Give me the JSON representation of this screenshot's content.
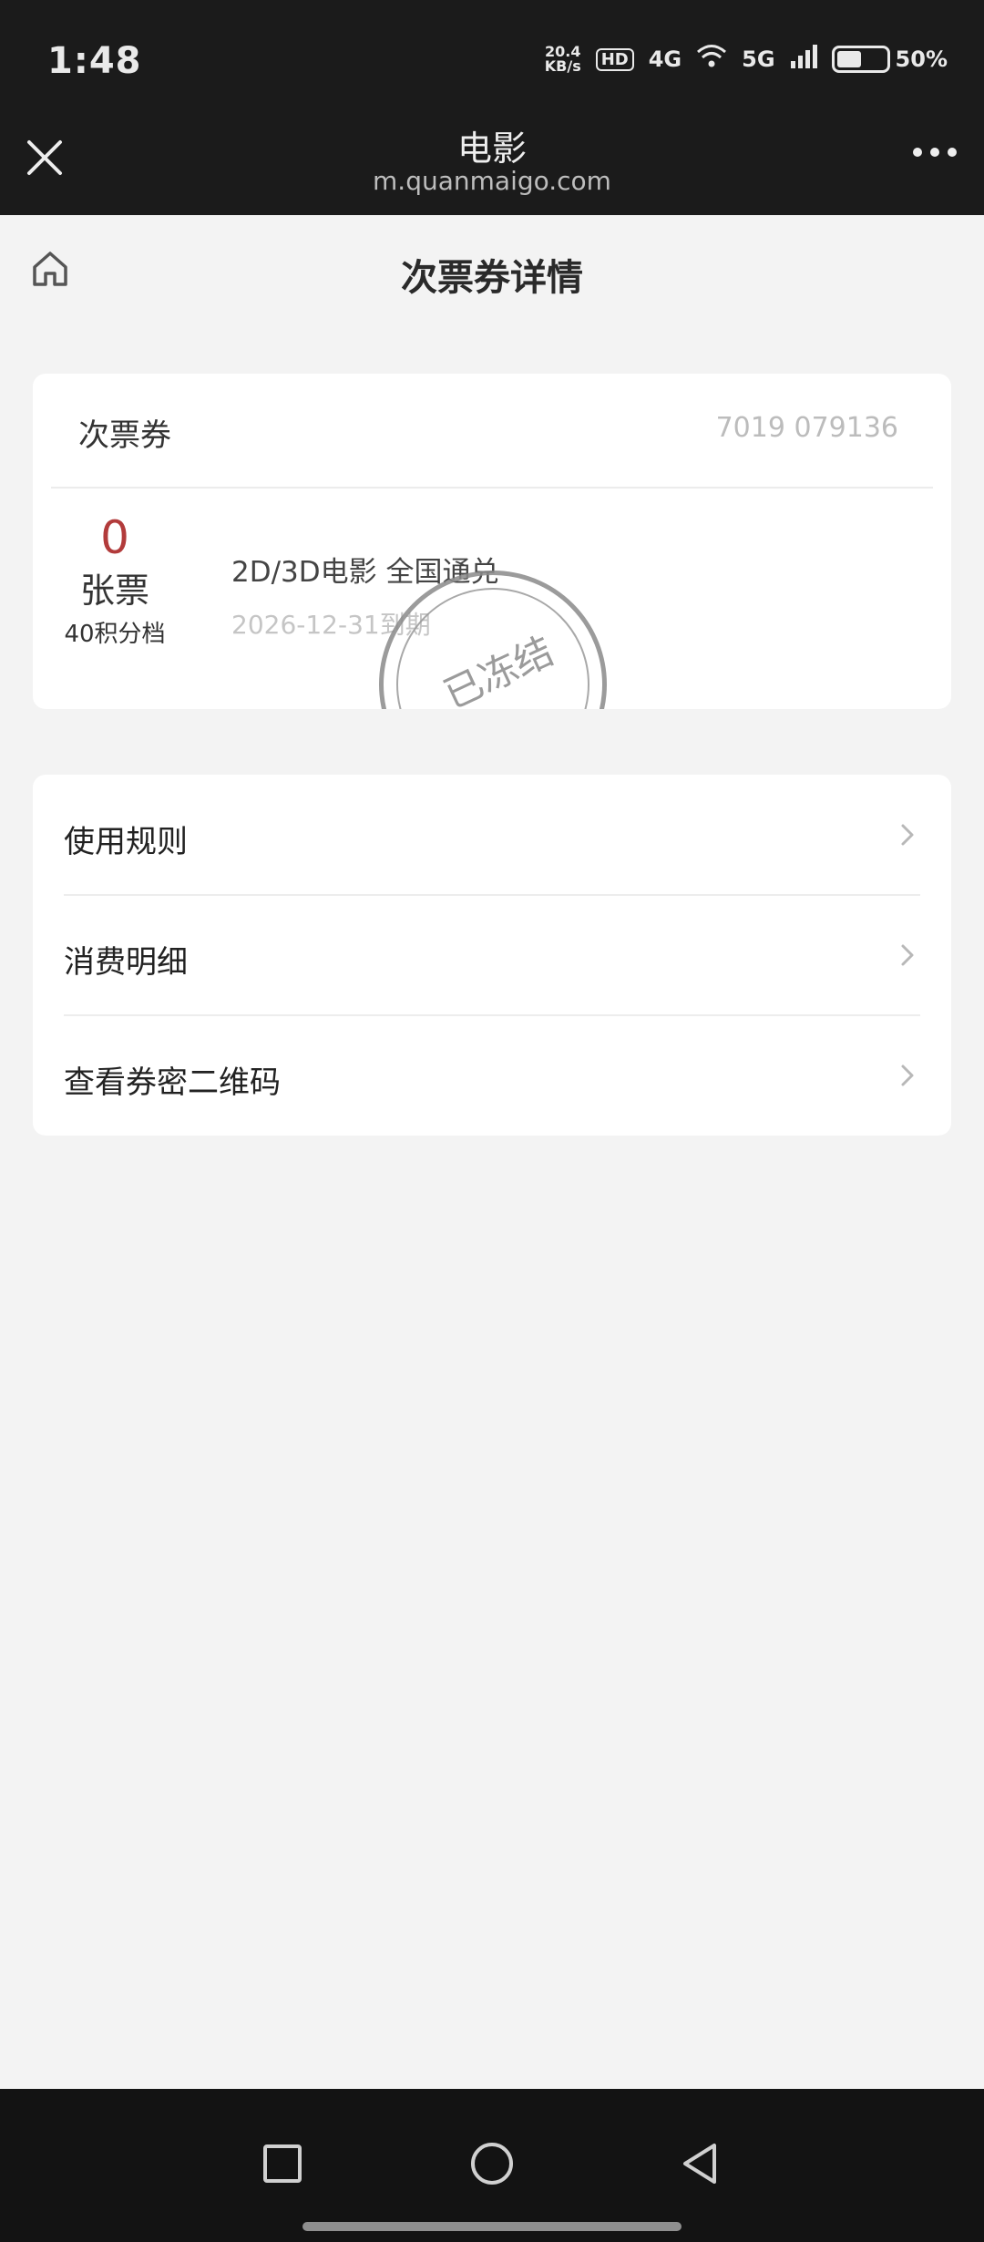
{
  "status_bar": {
    "time": "1:48",
    "net_speed_value": "20.4",
    "net_speed_unit": "KB/s",
    "hd_label": "HD",
    "signal_1": "4G",
    "signal_2": "5G",
    "battery_percent": "50%",
    "battery_level": 0.5
  },
  "browser": {
    "title": "电影",
    "url": "m.quanmaigo.com"
  },
  "page": {
    "title": "次票券详情"
  },
  "voucher": {
    "type_label": "次票券",
    "number": "7019 079136",
    "count": "0",
    "unit": "张票",
    "points_tier": "40积分档",
    "description": "2D/3D电影 全国通兑",
    "expiry": "2026-12-31到期",
    "stamp_text": "已冻结"
  },
  "menu": {
    "items": [
      {
        "label": "使用规则"
      },
      {
        "label": "消费明细"
      },
      {
        "label": "查看券密二维码"
      }
    ]
  },
  "colors": {
    "count_red": "#b23b3b",
    "page_bg": "#f3f3f3",
    "header_bg": "#1b1b1b"
  },
  "icons": {
    "close": "close-icon",
    "more": "more-icon",
    "home": "home-icon",
    "chevron": "chevron-right-icon",
    "nav_recent": "square-icon",
    "nav_home": "circle-icon",
    "nav_back": "triangle-back-icon"
  }
}
